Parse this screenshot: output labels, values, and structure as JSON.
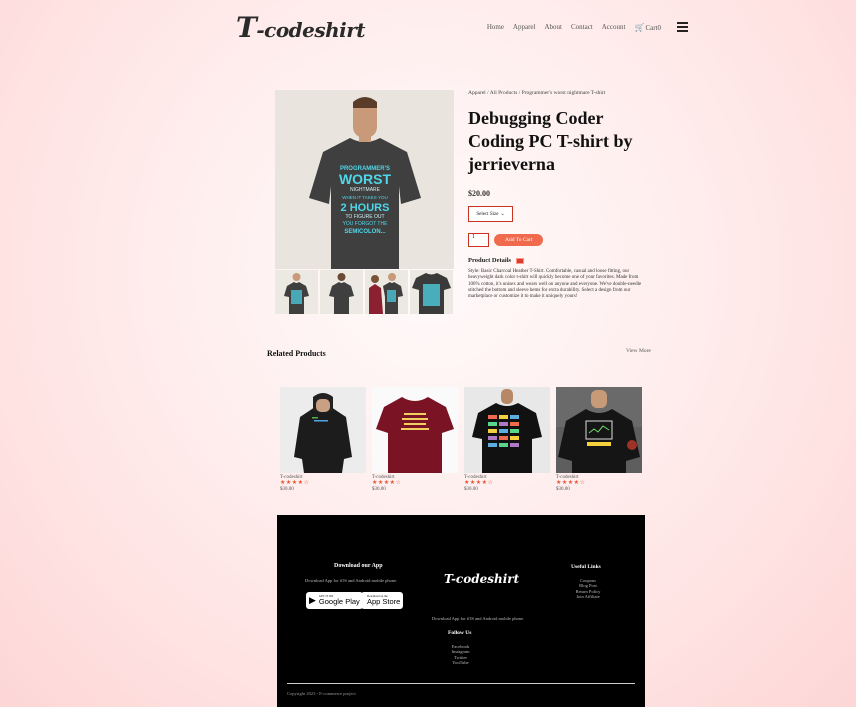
{
  "header": {
    "logo_initial": "T",
    "logo_rest": "-codeshirt",
    "nav": [
      "Home",
      "Apparel",
      "About",
      "Contact",
      "Account"
    ],
    "cart_label": "Cart0"
  },
  "product": {
    "breadcrumb": "Apparel / All Products / Programmer's worst nightmare T-shirt",
    "title": "Debugging Coder Coding PC T-shirt by jerrieverna",
    "price": "$20.00",
    "size_select": "Select Size",
    "quantity": "1",
    "add_to_cart": "Add To Cart",
    "details_label": "Product Details",
    "description": "Style: Basic Charcoal Heather T-Shirt. Comfortable, casual and loose fitting, our heavyweight dark color t-shirt will quickly become one of your favorites. Made from 100% cotton, it's unisex and wears well on anyone and everyone. We've double-needle stitched the bottom and sleeve hems for extra durability. Select a design from our marketplace or customize it to make it uniquely yours!",
    "shirt_text": [
      "PROGRAMMER'S",
      "WORST",
      "NIGHTMARE",
      "WHEN IT TAKES YOU",
      "2 HOURS",
      "TO FIGURE OUT",
      "YOU FORGOT THE",
      "SEMICOLON..."
    ]
  },
  "related": {
    "title": "Related Products",
    "view_more": "View More",
    "items": [
      {
        "name": "T-codeshirt",
        "stars": "★★★★☆",
        "price": "$30.00"
      },
      {
        "name": "T-codeshirt",
        "stars": "★★★★☆",
        "price": "$30.00"
      },
      {
        "name": "T-codeshirt",
        "stars": "★★★★☆",
        "price": "$30.00"
      },
      {
        "name": "T-codeshirt",
        "stars": "★★★★☆",
        "price": "$30.00"
      }
    ]
  },
  "footer": {
    "download_title": "Download our App",
    "download_sub": "Download App for iOS and Android mobile phone.",
    "google_small": "GET IT ON",
    "google_big": "Google Play",
    "apple_small": "Download on the",
    "apple_big": "App Store",
    "logo": "T-codeshirt",
    "download_sub2": "Download App for iOS and Android mobile phone.",
    "follow_title": "Follow Us",
    "social": [
      "Facebook",
      "Instagram",
      "Twitter",
      "YouTube"
    ],
    "useful_title": "Useful Links",
    "links": [
      "Coupons",
      "Blog Post",
      "Return Policy",
      "Join Affiliate"
    ],
    "copyright": "Copyright 2023 - E-commerce project"
  },
  "colors": {
    "accent": "#f06b4e",
    "footer_bg": "#000000",
    "border_red": "#cc3322"
  }
}
